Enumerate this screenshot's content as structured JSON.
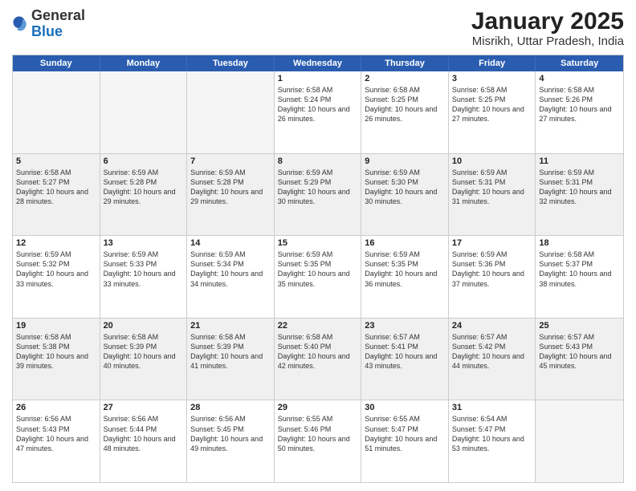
{
  "header": {
    "logo": {
      "general": "General",
      "blue": "Blue"
    },
    "title": "January 2025",
    "subtitle": "Misrikh, Uttar Pradesh, India"
  },
  "calendar": {
    "days": [
      "Sunday",
      "Monday",
      "Tuesday",
      "Wednesday",
      "Thursday",
      "Friday",
      "Saturday"
    ],
    "weeks": [
      [
        {
          "day": "",
          "empty": true
        },
        {
          "day": "",
          "empty": true
        },
        {
          "day": "",
          "empty": true
        },
        {
          "day": "1",
          "sunrise": "Sunrise: 6:58 AM",
          "sunset": "Sunset: 5:24 PM",
          "daylight": "Daylight: 10 hours and 26 minutes."
        },
        {
          "day": "2",
          "sunrise": "Sunrise: 6:58 AM",
          "sunset": "Sunset: 5:25 PM",
          "daylight": "Daylight: 10 hours and 26 minutes."
        },
        {
          "day": "3",
          "sunrise": "Sunrise: 6:58 AM",
          "sunset": "Sunset: 5:25 PM",
          "daylight": "Daylight: 10 hours and 27 minutes."
        },
        {
          "day": "4",
          "sunrise": "Sunrise: 6:58 AM",
          "sunset": "Sunset: 5:26 PM",
          "daylight": "Daylight: 10 hours and 27 minutes."
        }
      ],
      [
        {
          "day": "5",
          "sunrise": "Sunrise: 6:58 AM",
          "sunset": "Sunset: 5:27 PM",
          "daylight": "Daylight: 10 hours and 28 minutes."
        },
        {
          "day": "6",
          "sunrise": "Sunrise: 6:59 AM",
          "sunset": "Sunset: 5:28 PM",
          "daylight": "Daylight: 10 hours and 29 minutes."
        },
        {
          "day": "7",
          "sunrise": "Sunrise: 6:59 AM",
          "sunset": "Sunset: 5:28 PM",
          "daylight": "Daylight: 10 hours and 29 minutes."
        },
        {
          "day": "8",
          "sunrise": "Sunrise: 6:59 AM",
          "sunset": "Sunset: 5:29 PM",
          "daylight": "Daylight: 10 hours and 30 minutes."
        },
        {
          "day": "9",
          "sunrise": "Sunrise: 6:59 AM",
          "sunset": "Sunset: 5:30 PM",
          "daylight": "Daylight: 10 hours and 30 minutes."
        },
        {
          "day": "10",
          "sunrise": "Sunrise: 6:59 AM",
          "sunset": "Sunset: 5:31 PM",
          "daylight": "Daylight: 10 hours and 31 minutes."
        },
        {
          "day": "11",
          "sunrise": "Sunrise: 6:59 AM",
          "sunset": "Sunset: 5:31 PM",
          "daylight": "Daylight: 10 hours and 32 minutes."
        }
      ],
      [
        {
          "day": "12",
          "sunrise": "Sunrise: 6:59 AM",
          "sunset": "Sunset: 5:32 PM",
          "daylight": "Daylight: 10 hours and 33 minutes."
        },
        {
          "day": "13",
          "sunrise": "Sunrise: 6:59 AM",
          "sunset": "Sunset: 5:33 PM",
          "daylight": "Daylight: 10 hours and 33 minutes."
        },
        {
          "day": "14",
          "sunrise": "Sunrise: 6:59 AM",
          "sunset": "Sunset: 5:34 PM",
          "daylight": "Daylight: 10 hours and 34 minutes."
        },
        {
          "day": "15",
          "sunrise": "Sunrise: 6:59 AM",
          "sunset": "Sunset: 5:35 PM",
          "daylight": "Daylight: 10 hours and 35 minutes."
        },
        {
          "day": "16",
          "sunrise": "Sunrise: 6:59 AM",
          "sunset": "Sunset: 5:35 PM",
          "daylight": "Daylight: 10 hours and 36 minutes."
        },
        {
          "day": "17",
          "sunrise": "Sunrise: 6:59 AM",
          "sunset": "Sunset: 5:36 PM",
          "daylight": "Daylight: 10 hours and 37 minutes."
        },
        {
          "day": "18",
          "sunrise": "Sunrise: 6:58 AM",
          "sunset": "Sunset: 5:37 PM",
          "daylight": "Daylight: 10 hours and 38 minutes."
        }
      ],
      [
        {
          "day": "19",
          "sunrise": "Sunrise: 6:58 AM",
          "sunset": "Sunset: 5:38 PM",
          "daylight": "Daylight: 10 hours and 39 minutes."
        },
        {
          "day": "20",
          "sunrise": "Sunrise: 6:58 AM",
          "sunset": "Sunset: 5:39 PM",
          "daylight": "Daylight: 10 hours and 40 minutes."
        },
        {
          "day": "21",
          "sunrise": "Sunrise: 6:58 AM",
          "sunset": "Sunset: 5:39 PM",
          "daylight": "Daylight: 10 hours and 41 minutes."
        },
        {
          "day": "22",
          "sunrise": "Sunrise: 6:58 AM",
          "sunset": "Sunset: 5:40 PM",
          "daylight": "Daylight: 10 hours and 42 minutes."
        },
        {
          "day": "23",
          "sunrise": "Sunrise: 6:57 AM",
          "sunset": "Sunset: 5:41 PM",
          "daylight": "Daylight: 10 hours and 43 minutes."
        },
        {
          "day": "24",
          "sunrise": "Sunrise: 6:57 AM",
          "sunset": "Sunset: 5:42 PM",
          "daylight": "Daylight: 10 hours and 44 minutes."
        },
        {
          "day": "25",
          "sunrise": "Sunrise: 6:57 AM",
          "sunset": "Sunset: 5:43 PM",
          "daylight": "Daylight: 10 hours and 45 minutes."
        }
      ],
      [
        {
          "day": "26",
          "sunrise": "Sunrise: 6:56 AM",
          "sunset": "Sunset: 5:43 PM",
          "daylight": "Daylight: 10 hours and 47 minutes."
        },
        {
          "day": "27",
          "sunrise": "Sunrise: 6:56 AM",
          "sunset": "Sunset: 5:44 PM",
          "daylight": "Daylight: 10 hours and 48 minutes."
        },
        {
          "day": "28",
          "sunrise": "Sunrise: 6:56 AM",
          "sunset": "Sunset: 5:45 PM",
          "daylight": "Daylight: 10 hours and 49 minutes."
        },
        {
          "day": "29",
          "sunrise": "Sunrise: 6:55 AM",
          "sunset": "Sunset: 5:46 PM",
          "daylight": "Daylight: 10 hours and 50 minutes."
        },
        {
          "day": "30",
          "sunrise": "Sunrise: 6:55 AM",
          "sunset": "Sunset: 5:47 PM",
          "daylight": "Daylight: 10 hours and 51 minutes."
        },
        {
          "day": "31",
          "sunrise": "Sunrise: 6:54 AM",
          "sunset": "Sunset: 5:47 PM",
          "daylight": "Daylight: 10 hours and 53 minutes."
        },
        {
          "day": "",
          "empty": true
        }
      ]
    ]
  }
}
